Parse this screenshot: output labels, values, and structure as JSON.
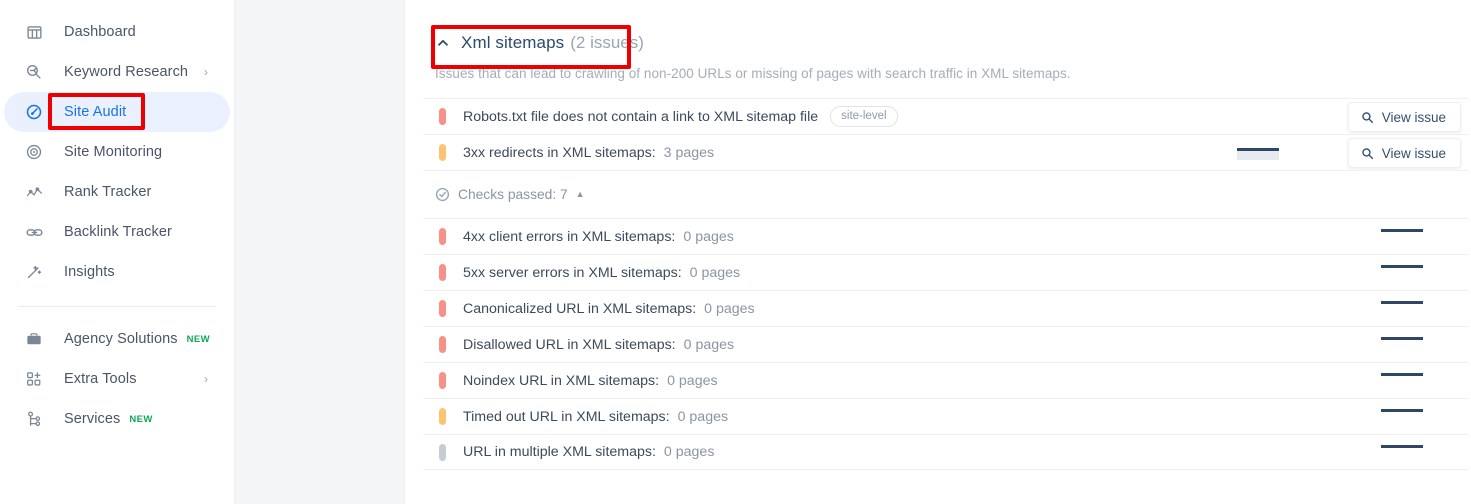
{
  "sidebar": {
    "items": [
      {
        "label": "Dashboard",
        "icon": "dashboard-icon",
        "chevron": false,
        "badge": null,
        "active": false
      },
      {
        "label": "Keyword Research",
        "icon": "keyword-search-icon",
        "chevron": true,
        "badge": null,
        "active": false
      },
      {
        "label": "Site Audit",
        "icon": "site-audit-gauge-icon",
        "chevron": false,
        "badge": null,
        "active": true
      },
      {
        "label": "Site Monitoring",
        "icon": "radar-icon",
        "chevron": false,
        "badge": null,
        "active": false
      },
      {
        "label": "Rank Tracker",
        "icon": "line-chart-icon",
        "chevron": false,
        "badge": null,
        "active": false
      },
      {
        "label": "Backlink Tracker",
        "icon": "link-icon",
        "chevron": false,
        "badge": null,
        "active": false
      },
      {
        "label": "Insights",
        "icon": "magic-wand-icon",
        "chevron": false,
        "badge": null,
        "active": false
      }
    ],
    "items_secondary": [
      {
        "label": "Agency Solutions",
        "icon": "briefcase-icon",
        "chevron": false,
        "badge": "NEW",
        "active": false
      },
      {
        "label": "Extra Tools",
        "icon": "grid-plus-icon",
        "chevron": true,
        "badge": null,
        "active": false
      },
      {
        "label": "Services",
        "icon": "sitemap-node-icon",
        "chevron": false,
        "badge": "NEW",
        "active": false
      }
    ],
    "chevron_glyph": "›"
  },
  "section": {
    "title": "Xml sitemaps",
    "count": "(2 issues)",
    "description": "Issues that can lead to crawling of non-200 URLs or missing of pages with search traffic in XML sitemaps.",
    "collapsed": false
  },
  "issues": [
    {
      "severity": "red",
      "label": "Robots.txt file does not contain a link to XML sitemap file",
      "value": "",
      "tag": "site-level",
      "sparkline": false,
      "action": "View issue"
    },
    {
      "severity": "orange",
      "label": "3xx redirects in XML sitemaps:",
      "value": "3 pages",
      "tag": null,
      "sparkline": true,
      "action": "View issue"
    }
  ],
  "checks_passed": {
    "label": "Checks passed: 7",
    "caret": "▲",
    "expanded": true
  },
  "passed_checks": [
    {
      "severity": "red",
      "label": "4xx client errors in XML sitemaps:",
      "value": "0 pages"
    },
    {
      "severity": "red",
      "label": "5xx server errors in XML sitemaps:",
      "value": "0 pages"
    },
    {
      "severity": "red",
      "label": "Canonicalized URL in XML sitemaps:",
      "value": "0 pages"
    },
    {
      "severity": "red",
      "label": "Disallowed URL in XML sitemaps:",
      "value": "0 pages"
    },
    {
      "severity": "red",
      "label": "Noindex URL in XML sitemaps:",
      "value": "0 pages"
    },
    {
      "severity": "orange",
      "label": "Timed out URL in XML sitemaps:",
      "value": "0 pages"
    },
    {
      "severity": "gray",
      "label": "URL in multiple XML sitemaps:",
      "value": "0 pages"
    }
  ],
  "colors": {
    "accent": "#1a73e8",
    "active_pill": "#eaf0fe",
    "severity_red": "#f79186",
    "severity_orange": "#fcc470",
    "severity_gray": "#c6ccd4",
    "annotation": "#ee0000",
    "badge_new": "#0fa958",
    "title": "#2b4a6f",
    "muted": "#9aa6b4"
  },
  "annotations": [
    {
      "name": "site-audit-highlight",
      "target": "Site Audit"
    },
    {
      "name": "xml-sitemaps-title-highlight",
      "target": "Xml sitemaps (2 issues)"
    }
  ]
}
